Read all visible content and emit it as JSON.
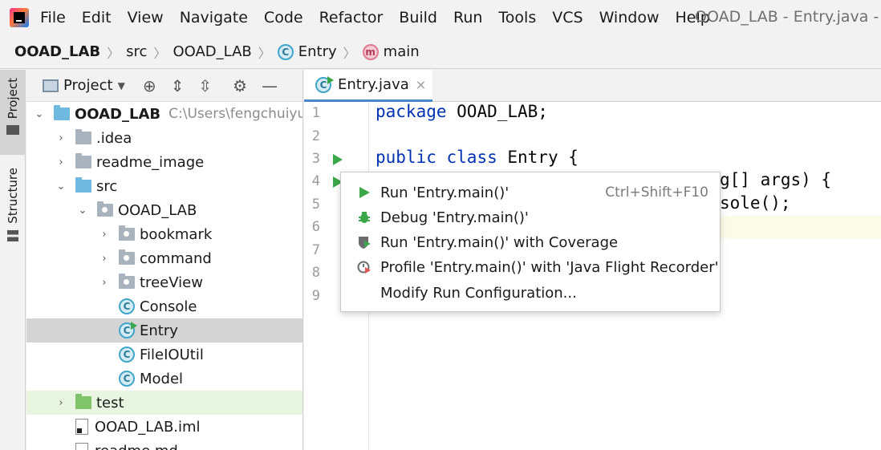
{
  "menubar": {
    "items": [
      "File",
      "Edit",
      "View",
      "Navigate",
      "Code",
      "Refactor",
      "Build",
      "Run",
      "Tools",
      "VCS",
      "Window",
      "Help"
    ],
    "window_title": "OOAD_LAB - Entry.java - Ad"
  },
  "breadcrumb": {
    "project": "OOAD_LAB",
    "src": "src",
    "package": "OOAD_LAB",
    "class": "Entry",
    "method": "main",
    "class_icon_letter": "C",
    "method_icon_letter": "m"
  },
  "sidebar": {
    "project_tab": "Project",
    "structure_tab": "Structure"
  },
  "project_panel": {
    "title": "Project",
    "dropdown_icon": "chevron-down-icon",
    "tools": [
      "locate-icon",
      "expand-all-icon",
      "collapse-all-icon",
      "gear-icon",
      "minimize-icon"
    ],
    "tree": [
      {
        "label": "OOAD_LAB",
        "path": "C:\\Users\\fengchuiyu",
        "arrow": "⌄",
        "icon": "module-folder",
        "level": 0,
        "bold": true
      },
      {
        "label": ".idea",
        "arrow": "›",
        "icon": "folder",
        "level": 1
      },
      {
        "label": "readme_image",
        "arrow": "›",
        "icon": "folder",
        "level": 1
      },
      {
        "label": "src",
        "arrow": "⌄",
        "icon": "source-folder",
        "level": 1
      },
      {
        "label": "OOAD_LAB",
        "arrow": "⌄",
        "icon": "package",
        "level": 2
      },
      {
        "label": "bookmark",
        "arrow": "›",
        "icon": "package",
        "level": 3
      },
      {
        "label": "command",
        "arrow": "›",
        "icon": "package",
        "level": 3
      },
      {
        "label": "treeView",
        "arrow": "›",
        "icon": "package",
        "level": 3
      },
      {
        "label": "Console",
        "arrow": "",
        "icon": "class",
        "level": 3
      },
      {
        "label": "Entry",
        "arrow": "",
        "icon": "class-run",
        "level": 3,
        "selected": true
      },
      {
        "label": "FileIOUtil",
        "arrow": "",
        "icon": "class",
        "level": 3
      },
      {
        "label": "Model",
        "arrow": "",
        "icon": "class",
        "level": 3
      },
      {
        "label": "test",
        "arrow": "›",
        "icon": "test-folder",
        "level": 1
      },
      {
        "label": "OOAD_LAB.iml",
        "arrow": "",
        "icon": "file",
        "level": 1
      },
      {
        "label": "readme.md",
        "arrow": "",
        "icon": "file",
        "level": 1
      }
    ]
  },
  "editor": {
    "tab_label": "Entry.java",
    "tab_close": "×",
    "line_numbers": [
      "1",
      "2",
      "3",
      "4",
      "5",
      "6",
      "7",
      "8",
      "9"
    ],
    "code": {
      "line1_kw": "package",
      "line1_rest": " OOAD_LAB;",
      "line3_kw1": "public",
      "line3_kw2": "class",
      "line3_rest": " Entry {",
      "line4_visible": "g[] args) {",
      "line5_visible": "sole();"
    }
  },
  "context_menu": {
    "items": [
      {
        "label": "Run 'Entry.main()'",
        "shortcut": "Ctrl+Shift+F10",
        "icon": "run-icon"
      },
      {
        "label": "Debug 'Entry.main()'",
        "shortcut": "",
        "icon": "debug-icon"
      },
      {
        "label": "Run 'Entry.main()' with Coverage",
        "shortcut": "",
        "icon": "coverage-icon"
      },
      {
        "label": "Profile 'Entry.main()' with 'Java Flight Recorder'",
        "shortcut": "",
        "icon": "profile-icon"
      },
      {
        "label": "Modify Run Configuration...",
        "shortcut": "",
        "icon": ""
      }
    ]
  },
  "colors": {
    "keyword": "#0033b3",
    "run_green": "#3aa84a",
    "selection": "#d5d5d5",
    "test_folder_bg": "#e8f5e0"
  }
}
